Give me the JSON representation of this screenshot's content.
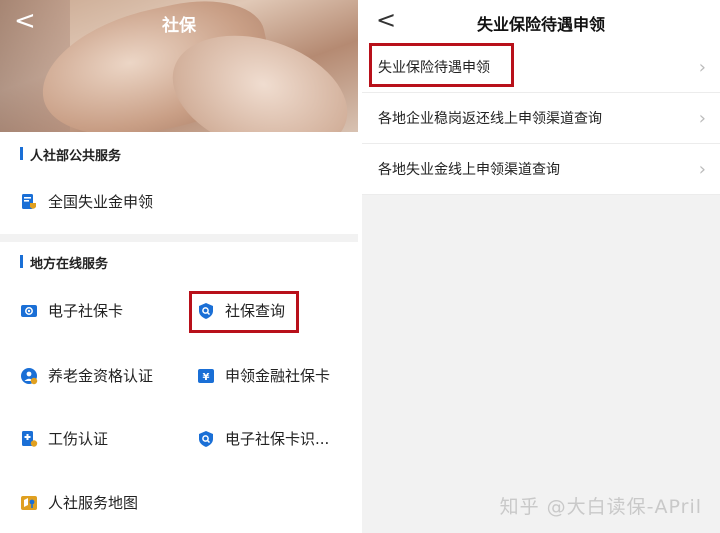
{
  "left": {
    "title": "社保",
    "back_icon": "<",
    "section1_title": "人社部公共服务",
    "section1_items": [
      {
        "label": "全国失业金申领",
        "icon": "document-shield-icon"
      }
    ],
    "section2_title": "地方在线服务",
    "section2_items": [
      {
        "label": "电子社保卡",
        "icon": "id-card-icon"
      },
      {
        "label": "社保查询",
        "icon": "search-shield-icon"
      },
      {
        "label": "养老金资格认证",
        "icon": "person-check-icon"
      },
      {
        "label": "申领金融社保卡",
        "icon": "yuan-card-icon"
      },
      {
        "label": "工伤认证",
        "icon": "injury-badge-icon"
      },
      {
        "label": "电子社保卡识...",
        "icon": "shield-scan-icon"
      },
      {
        "label": "人社服务地图",
        "icon": "map-icon"
      }
    ]
  },
  "right": {
    "title": "失业保险待遇申领",
    "back_icon": "<",
    "rows": [
      {
        "label": "失业保险待遇申领"
      },
      {
        "label": "各地企业稳岗返还线上申领渠道查询"
      },
      {
        "label": "各地失业金线上申领渠道查询"
      }
    ],
    "chevron": "›"
  },
  "watermark": "知乎 @大白读保-APril",
  "colors": {
    "accent": "#1a6fd6",
    "highlight": "#b8101a",
    "gold": "#e0a020"
  }
}
